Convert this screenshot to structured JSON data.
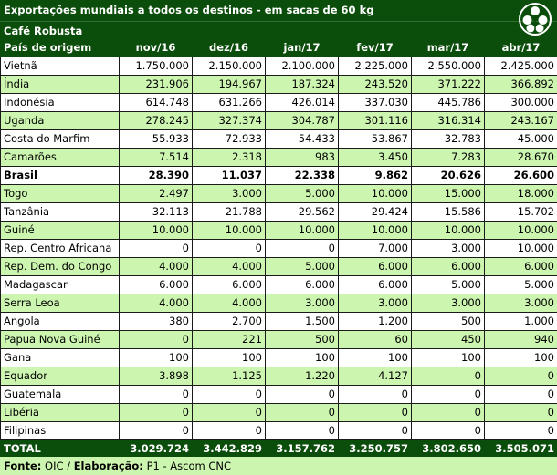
{
  "title": "Exportações mundiais a todos os destinos - em sacas de 60 kg",
  "subtitle": "Café Robusta",
  "logo_icon": "coffee-council-logo-icon",
  "columns": [
    "País de origem",
    "nov/16",
    "dez/16",
    "jan/17",
    "fev/17",
    "mar/17",
    "abr/17"
  ],
  "rows": [
    {
      "country": "Vietnã",
      "values": [
        "1.750.000",
        "2.150.000",
        "2.100.000",
        "2.225.000",
        "2.550.000",
        "2.425.000"
      ],
      "bold": false
    },
    {
      "country": "Índia",
      "values": [
        "231.906",
        "194.967",
        "187.324",
        "243.520",
        "371.222",
        "366.892"
      ],
      "bold": false
    },
    {
      "country": "Indonésia",
      "values": [
        "614.748",
        "631.266",
        "426.014",
        "337.030",
        "445.786",
        "300.000"
      ],
      "bold": false
    },
    {
      "country": "Uganda",
      "values": [
        "278.245",
        "327.374",
        "304.787",
        "301.116",
        "316.314",
        "243.167"
      ],
      "bold": false
    },
    {
      "country": "Costa do Marfim",
      "values": [
        "55.933",
        "72.933",
        "54.433",
        "53.867",
        "32.783",
        "45.000"
      ],
      "bold": false
    },
    {
      "country": "Camarões",
      "values": [
        "7.514",
        "2.318",
        "983",
        "3.450",
        "7.283",
        "28.670"
      ],
      "bold": false
    },
    {
      "country": "Brasil",
      "values": [
        "28.390",
        "11.037",
        "22.338",
        "9.862",
        "20.626",
        "26.600"
      ],
      "bold": true
    },
    {
      "country": "Togo",
      "values": [
        "2.497",
        "3.000",
        "5.000",
        "10.000",
        "15.000",
        "18.000"
      ],
      "bold": false
    },
    {
      "country": "Tanzânia",
      "values": [
        "32.113",
        "21.788",
        "29.562",
        "29.424",
        "15.586",
        "15.702"
      ],
      "bold": false
    },
    {
      "country": "Guiné",
      "values": [
        "10.000",
        "10.000",
        "10.000",
        "10.000",
        "10.000",
        "10.000"
      ],
      "bold": false
    },
    {
      "country": "Rep. Centro Africana",
      "values": [
        "0",
        "0",
        "0",
        "7.000",
        "3.000",
        "10.000"
      ],
      "bold": false
    },
    {
      "country": "Rep. Dem. do Congo",
      "values": [
        "4.000",
        "4.000",
        "5.000",
        "6.000",
        "6.000",
        "6.000"
      ],
      "bold": false
    },
    {
      "country": "Madagascar",
      "values": [
        "6.000",
        "6.000",
        "6.000",
        "6.000",
        "5.000",
        "5.000"
      ],
      "bold": false
    },
    {
      "country": "Serra Leoa",
      "values": [
        "4.000",
        "4.000",
        "3.000",
        "3.000",
        "3.000",
        "3.000"
      ],
      "bold": false
    },
    {
      "country": "Angola",
      "values": [
        "380",
        "2.700",
        "1.500",
        "1.200",
        "500",
        "1.000"
      ],
      "bold": false
    },
    {
      "country": "Papua Nova Guiné",
      "values": [
        "0",
        "221",
        "500",
        "60",
        "450",
        "940"
      ],
      "bold": false
    },
    {
      "country": "Gana",
      "values": [
        "100",
        "100",
        "100",
        "100",
        "100",
        "100"
      ],
      "bold": false
    },
    {
      "country": "Equador",
      "values": [
        "3.898",
        "1.125",
        "1.220",
        "4.127",
        "0",
        "0"
      ],
      "bold": false
    },
    {
      "country": "Guatemala",
      "values": [
        "0",
        "0",
        "0",
        "0",
        "0",
        "0"
      ],
      "bold": false
    },
    {
      "country": "Libéria",
      "values": [
        "0",
        "0",
        "0",
        "0",
        "0",
        "0"
      ],
      "bold": false
    },
    {
      "country": "Filipinas",
      "values": [
        "0",
        "0",
        "0",
        "0",
        "0",
        "0"
      ],
      "bold": false
    }
  ],
  "total": {
    "label": "TOTAL",
    "values": [
      "3.029.724",
      "3.442.829",
      "3.157.762",
      "3.250.757",
      "3.802.650",
      "3.505.071"
    ]
  },
  "footer": {
    "label_fonte": "Fonte:",
    "fonte": "OIC / ",
    "label_elab": "Elaboração:",
    "elab": "P1 - Ascom CNC"
  },
  "colors": {
    "dark_green": "#0b4d0b",
    "light_green": "#ccf5b0",
    "white": "#ffffff"
  }
}
